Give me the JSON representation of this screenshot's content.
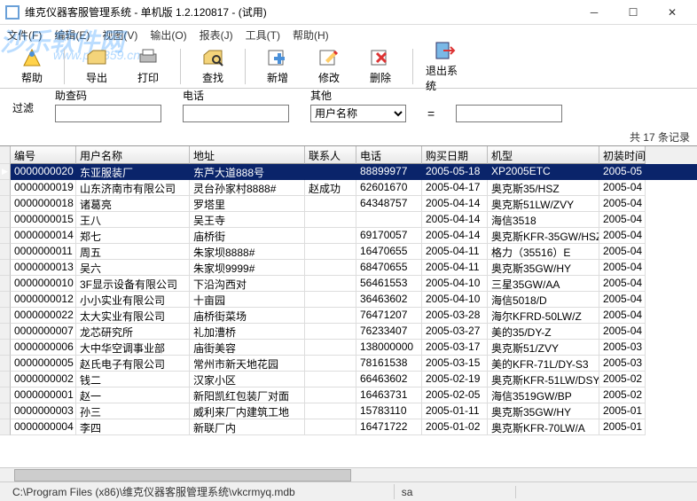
{
  "window": {
    "title": "维克仪器客服管理系统 - 单机版 1.2.120817 - (试用)"
  },
  "menu": {
    "file": "文件(F)",
    "edit": "编辑(E)",
    "view": "视图(V)",
    "output": "输出(O)",
    "report": "报表(J)",
    "tools": "工具(T)",
    "help": "帮助(H)"
  },
  "watermark": {
    "main": "沙乐软件网",
    "sub": "www.pc0359.cn"
  },
  "toolbar": {
    "help": "帮助",
    "export": "导出",
    "print": "打印",
    "find": "查找",
    "add": "新增",
    "modify": "修改",
    "delete": "删除",
    "exit": "退出系统"
  },
  "filter": {
    "label1": "助查码",
    "label2": "电话",
    "label3": "其他",
    "select_value": "用户名称",
    "label_top": "过滤"
  },
  "record_count": "共 17 条记录",
  "columns": {
    "id": "编号",
    "name": "用户名称",
    "addr": "地址",
    "contact": "联系人",
    "phone": "电话",
    "buydate": "购买日期",
    "model": "机型",
    "installdate": "初装时间"
  },
  "rows": [
    {
      "id": "0000000020",
      "name": "东亚服装厂",
      "addr": "东芦大道888号",
      "contact": "",
      "phone": "88899977",
      "buydate": "2005-05-18",
      "model": "XP2005ETC",
      "inst": "2005-05"
    },
    {
      "id": "0000000019",
      "name": "山东济南市有限公司",
      "addr": "灵台孙家村8888#",
      "contact": "赵成功",
      "phone": "62601670",
      "buydate": "2005-04-17",
      "model": "奥克斯35/HSZ",
      "inst": "2005-04"
    },
    {
      "id": "0000000018",
      "name": "诸葛亮",
      "addr": "罗塔里",
      "contact": "",
      "phone": "64348757",
      "buydate": "2005-04-14",
      "model": "奥克斯51LW/ZVY",
      "inst": "2005-04"
    },
    {
      "id": "0000000015",
      "name": "王八",
      "addr": "吴王寺",
      "contact": "",
      "phone": "",
      "buydate": "2005-04-14",
      "model": "海信3518",
      "inst": "2005-04"
    },
    {
      "id": "0000000014",
      "name": "郑七",
      "addr": "庙桥街",
      "contact": "",
      "phone": "69170057",
      "buydate": "2005-04-14",
      "model": "奥克斯KFR-35GW/HSZ",
      "inst": "2005-04"
    },
    {
      "id": "0000000011",
      "name": "周五",
      "addr": "朱家坝8888#",
      "contact": "",
      "phone": "16470655",
      "buydate": "2005-04-11",
      "model": "格力（35516）E",
      "inst": "2005-04"
    },
    {
      "id": "0000000013",
      "name": "吴六",
      "addr": "朱家坝9999#",
      "contact": "",
      "phone": "68470655",
      "buydate": "2005-04-11",
      "model": "奥克斯35GW/HY",
      "inst": "2005-04"
    },
    {
      "id": "0000000010",
      "name": "3F显示设备有限公司",
      "addr": "下沿沟西对",
      "contact": "",
      "phone": "56461553",
      "buydate": "2005-04-10",
      "model": "三星35GW/AA",
      "inst": "2005-04"
    },
    {
      "id": "0000000012",
      "name": "小小实业有限公司",
      "addr": "十亩园",
      "contact": "",
      "phone": "36463602",
      "buydate": "2005-04-10",
      "model": "海信5018/D",
      "inst": "2005-04"
    },
    {
      "id": "0000000022",
      "name": "太大实业有限公司",
      "addr": "庙桥街菜场",
      "contact": "",
      "phone": "76471207",
      "buydate": "2005-03-28",
      "model": "海尔KFRD-50LW/Z",
      "inst": "2005-04"
    },
    {
      "id": "0000000007",
      "name": "龙芯研究所",
      "addr": "礼加漕桥",
      "contact": "",
      "phone": "76233407",
      "buydate": "2005-03-27",
      "model": "美的35/DY-Z",
      "inst": "2005-04"
    },
    {
      "id": "0000000006",
      "name": "大中华空调事业部",
      "addr": "庙街美容",
      "contact": "",
      "phone": "138000000",
      "buydate": "2005-03-17",
      "model": "奥克斯51/ZVY",
      "inst": "2005-03"
    },
    {
      "id": "0000000005",
      "name": "赵氏电子有限公司",
      "addr": "常州市新天地花园",
      "contact": "",
      "phone": "78161538",
      "buydate": "2005-03-15",
      "model": "美的KFR-71L/DY-S3",
      "inst": "2005-03"
    },
    {
      "id": "0000000002",
      "name": "钱二",
      "addr": "汉家小区",
      "contact": "",
      "phone": "66463602",
      "buydate": "2005-02-19",
      "model": "奥克斯KFR-51LW/DSY",
      "inst": "2005-02"
    },
    {
      "id": "0000000001",
      "name": "赵一",
      "addr": "新阳凯红包装厂对面",
      "contact": "",
      "phone": "16463731",
      "buydate": "2005-02-05",
      "model": "海信3519GW/BP",
      "inst": "2005-02"
    },
    {
      "id": "0000000003",
      "name": "孙三",
      "addr": "威利来厂内建筑工地",
      "contact": "",
      "phone": "15783110",
      "buydate": "2005-01-11",
      "model": "奥克斯35GW/HY",
      "inst": "2005-01"
    },
    {
      "id": "0000000004",
      "name": "李四",
      "addr": "新联厂内",
      "contact": "",
      "phone": "16471722",
      "buydate": "2005-01-02",
      "model": "奥克斯KFR-70LW/A",
      "inst": "2005-01"
    }
  ],
  "statusbar": {
    "path": "C:\\Program Files (x86)\\维克仪器客服管理系统\\vkcrmyq.mdb",
    "user": "sa"
  }
}
